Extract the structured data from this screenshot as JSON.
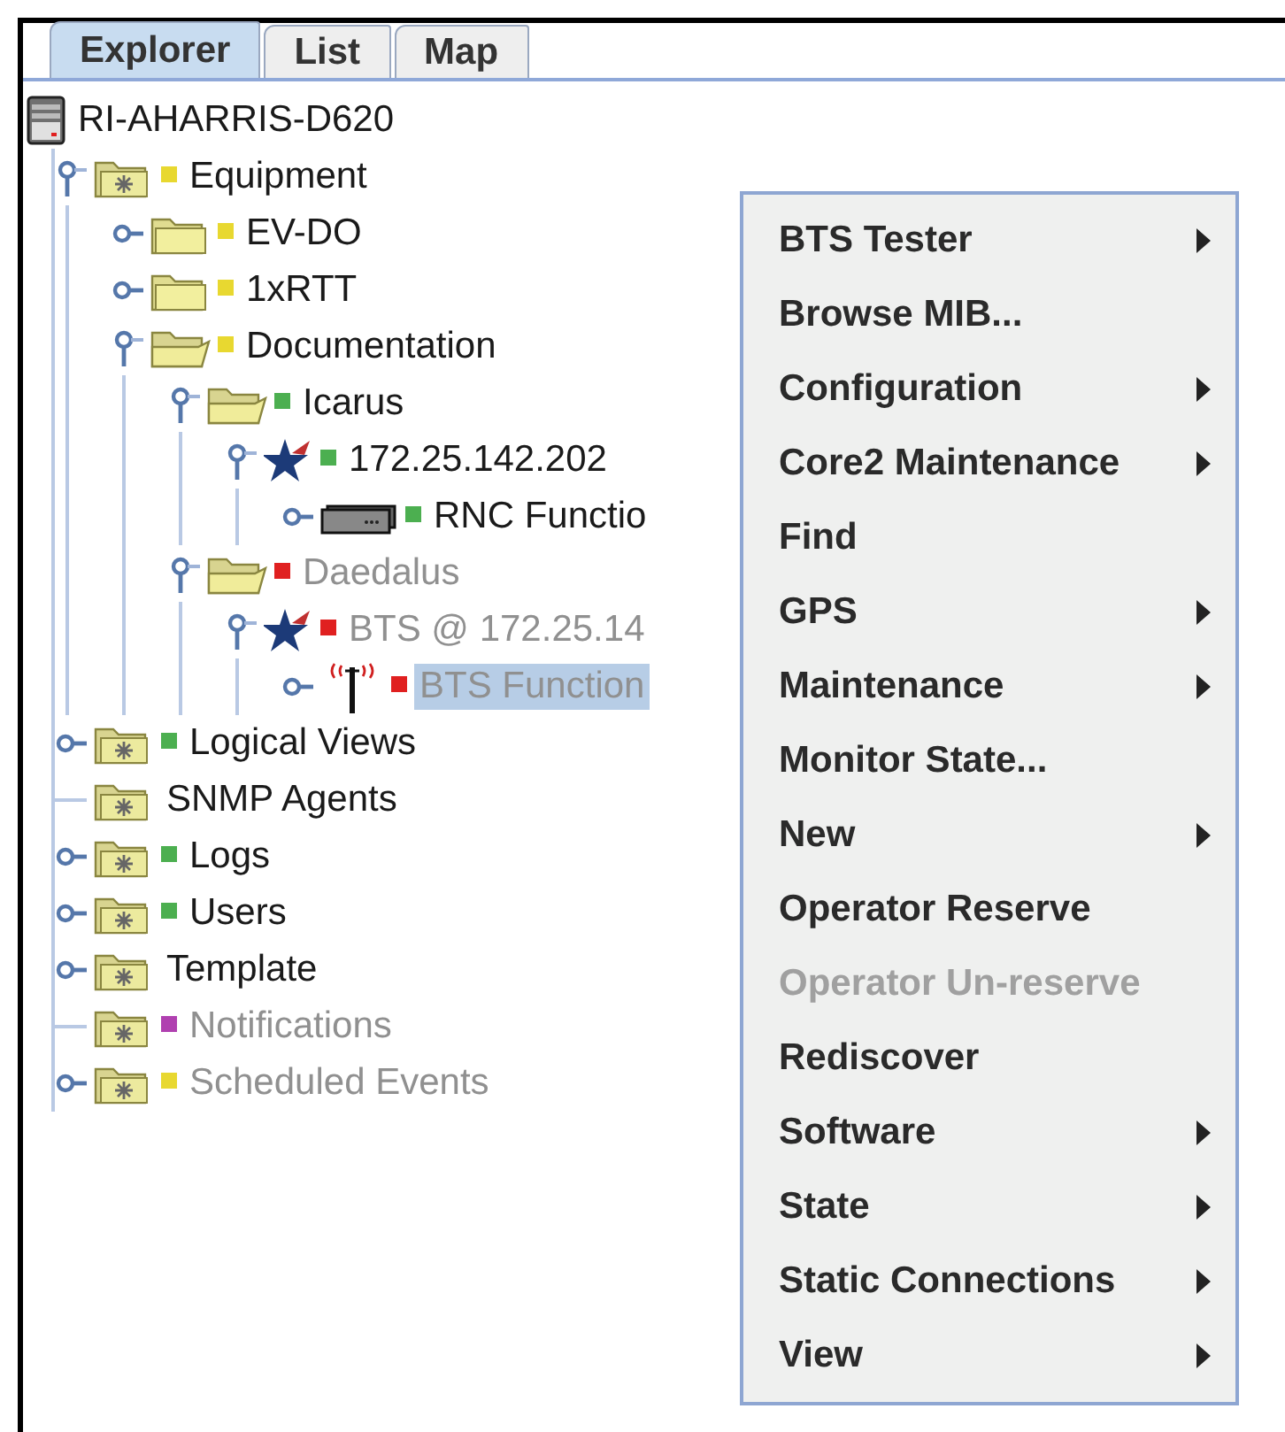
{
  "tabs": [
    {
      "label": "Explorer",
      "selected": true
    },
    {
      "label": "List",
      "selected": false
    },
    {
      "label": "Map",
      "selected": false
    }
  ],
  "tree": {
    "label": "RI-AHARRIS-D620",
    "kind": "server",
    "children": [
      {
        "label": "Equipment",
        "kind": "folder-star",
        "color": "#e8d830",
        "expandable": true,
        "expanded": true,
        "dimmed": false,
        "selected": false,
        "children": [
          {
            "label": "EV-DO",
            "kind": "folder",
            "color": "#e8d830",
            "expandable": true,
            "expanded": false,
            "dimmed": false,
            "selected": false
          },
          {
            "label": "1xRTT",
            "kind": "folder",
            "color": "#e8d830",
            "expandable": true,
            "expanded": false,
            "dimmed": false,
            "selected": false
          },
          {
            "label": "Documentation",
            "kind": "folder-open",
            "color": "#e8d830",
            "expandable": true,
            "expanded": true,
            "dimmed": false,
            "selected": false,
            "children": [
              {
                "label": "Icarus",
                "kind": "folder-open",
                "color": "#4caf50",
                "expandable": true,
                "expanded": true,
                "dimmed": false,
                "selected": false,
                "children": [
                  {
                    "label": "172.25.142.202",
                    "kind": "star",
                    "color": "#4caf50",
                    "expandable": true,
                    "expanded": true,
                    "dimmed": false,
                    "selected": false,
                    "children": [
                      {
                        "label": "RNC Functio",
                        "kind": "device",
                        "color": "#4caf50",
                        "expandable": true,
                        "expanded": false,
                        "dimmed": false,
                        "selected": false
                      }
                    ]
                  }
                ]
              },
              {
                "label": "Daedalus",
                "kind": "folder-open",
                "color": "#e02020",
                "expandable": true,
                "expanded": true,
                "dimmed": true,
                "selected": false,
                "children": [
                  {
                    "label": "BTS @ 172.25.14",
                    "kind": "star",
                    "color": "#e02020",
                    "expandable": true,
                    "expanded": true,
                    "dimmed": true,
                    "selected": false,
                    "children": [
                      {
                        "label": "BTS Function",
                        "kind": "antenna",
                        "color": "#e02020",
                        "expandable": true,
                        "expanded": false,
                        "dimmed": true,
                        "selected": true
                      }
                    ]
                  }
                ]
              }
            ]
          }
        ]
      },
      {
        "label": "Logical Views",
        "kind": "folder-star",
        "color": "#4caf50",
        "expandable": true,
        "expanded": false,
        "dimmed": false,
        "selected": false
      },
      {
        "label": "SNMP Agents",
        "kind": "folder-star",
        "expandable": false,
        "dimmed": false,
        "selected": false
      },
      {
        "label": "Logs",
        "kind": "folder-star",
        "color": "#4caf50",
        "expandable": true,
        "expanded": false,
        "dimmed": false,
        "selected": false
      },
      {
        "label": "Users",
        "kind": "folder-star",
        "color": "#4caf50",
        "expandable": true,
        "expanded": false,
        "dimmed": false,
        "selected": false
      },
      {
        "label": "Template",
        "kind": "folder-star",
        "expandable": true,
        "expanded": false,
        "dimmed": false,
        "selected": false
      },
      {
        "label": "Notifications",
        "kind": "folder-star",
        "color": "#b040b0",
        "expandable": false,
        "dimmed": true,
        "selected": false
      },
      {
        "label": "Scheduled Events",
        "kind": "folder-star",
        "color": "#e8d830",
        "expandable": true,
        "expanded": false,
        "dimmed": true,
        "selected": false
      }
    ]
  },
  "context_menu": [
    {
      "label": "BTS Tester",
      "submenu": true,
      "disabled": false
    },
    {
      "label": "Browse MIB...",
      "submenu": false,
      "disabled": false
    },
    {
      "label": "Configuration",
      "submenu": true,
      "disabled": false
    },
    {
      "label": "Core2 Maintenance",
      "submenu": true,
      "disabled": false
    },
    {
      "label": "Find",
      "submenu": false,
      "disabled": false
    },
    {
      "label": "GPS",
      "submenu": true,
      "disabled": false
    },
    {
      "label": "Maintenance",
      "submenu": true,
      "disabled": false
    },
    {
      "label": "Monitor State...",
      "submenu": false,
      "disabled": false
    },
    {
      "label": "New",
      "submenu": true,
      "disabled": false
    },
    {
      "label": "Operator Reserve",
      "submenu": false,
      "disabled": false
    },
    {
      "label": "Operator Un-reserve",
      "submenu": false,
      "disabled": true
    },
    {
      "label": "Rediscover",
      "submenu": false,
      "disabled": false
    },
    {
      "label": "Software",
      "submenu": true,
      "disabled": false
    },
    {
      "label": "State",
      "submenu": true,
      "disabled": false
    },
    {
      "label": "Static Connections",
      "submenu": true,
      "disabled": false
    },
    {
      "label": "View",
      "submenu": true,
      "disabled": false
    }
  ]
}
